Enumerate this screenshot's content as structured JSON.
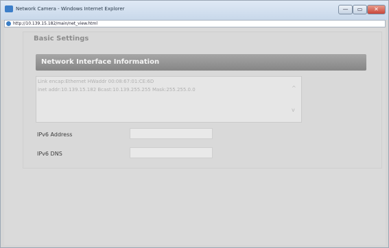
{
  "window": {
    "title": "Network Camera - Windows Internet Explorer",
    "url": "http://10.139.15.182/main/net_view.html",
    "min_label": "—",
    "max_label": "▭",
    "close_label": "✕"
  },
  "panel": {
    "title": "Basic Settings",
    "section_title": "Network Interface Information",
    "info_lines": [
      "Link encap:Ethernet  HWaddr 00:08:67:01:CE:6D",
      "inet addr:10.139.15.182  Bcast:10.139.255.255  Mask:255.255.0.0"
    ],
    "scroll_up": "^",
    "scroll_down": "v"
  },
  "fields": {
    "ipv6_address": {
      "label": "IPv6 Address",
      "value": ""
    },
    "ipv6_dns": {
      "label": "IPv6 DNS",
      "value": ""
    }
  }
}
